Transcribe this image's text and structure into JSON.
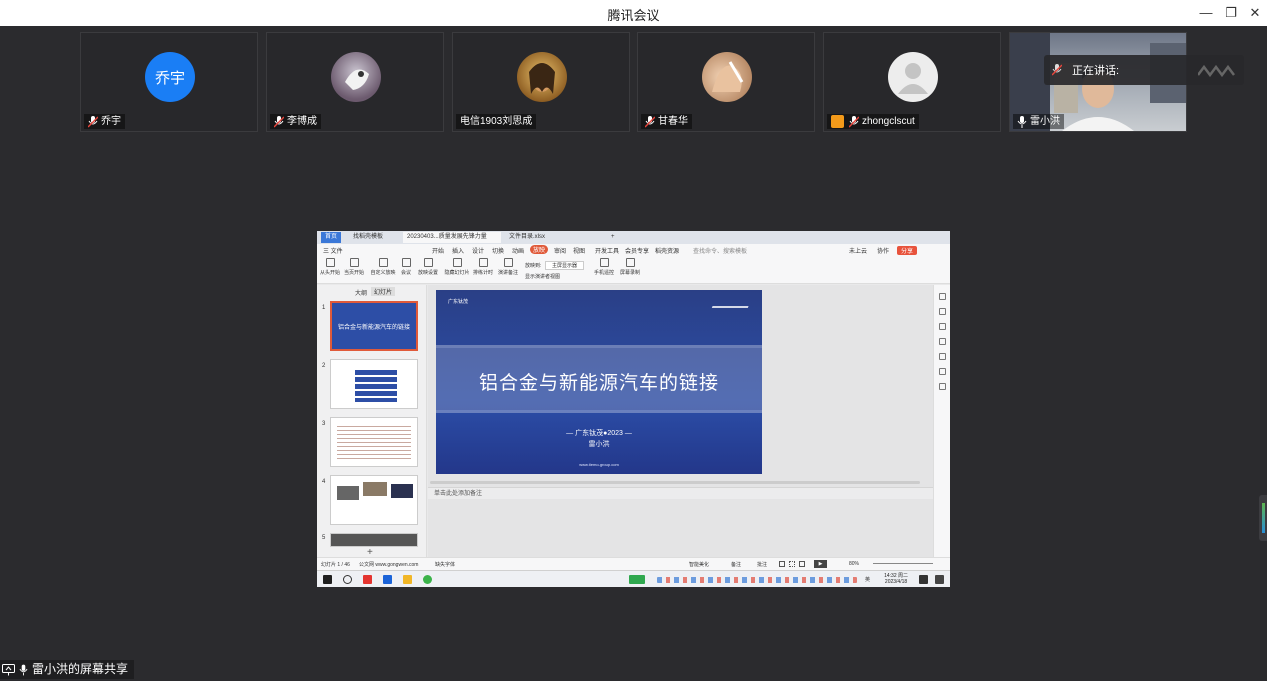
{
  "window": {
    "title": "腾讯会议"
  },
  "participants": [
    {
      "name": "乔宇",
      "avatar_text": "乔宇",
      "avatar_color": "#1a7ef5"
    },
    {
      "name": "李博成"
    },
    {
      "name": "电信1903刘思成"
    },
    {
      "name": "甘春华"
    },
    {
      "name": "zhongclscut"
    },
    {
      "name": "雷小洪"
    }
  ],
  "speaking_label": "正在讲话:",
  "share_label": "雷小洪的屏幕共享",
  "shared_screen": {
    "tabs": [
      "首页",
      "找稻壳模板",
      "20230403...质量发展先锋力量",
      "文件目录.xlsx"
    ],
    "menu": [
      "三 文件",
      "开始",
      "插入",
      "设计",
      "切换",
      "动画",
      "放映",
      "审阅",
      "视图",
      "开发工具",
      "会员专享",
      "稻壳资源",
      "查找命令、搜索模板"
    ],
    "menu_right": [
      "未上云",
      "协作",
      "分享"
    ],
    "ribbon": [
      "从头开始",
      "当页开始",
      "自定义放映",
      "会议",
      "放映设置",
      "隐藏幻灯片",
      "排练计时",
      "演讲备注",
      "手机遥控",
      "屏幕录制"
    ],
    "ribbon_options": {
      "display_label": "放映到:",
      "display_value": "主屏显示器",
      "presenter_view": "显示演讲者视图"
    },
    "panel_tabs": [
      "大纲",
      "幻灯片"
    ],
    "thumb_numbers": [
      "1",
      "2",
      "3",
      "4",
      "5"
    ],
    "thumb1_title": "铝合金与新能源汽车的链接",
    "slide": {
      "tag": "广东钛茂",
      "title": "铝合金与新能源汽车的链接",
      "subtitle": "— 广东钛茂●2023 —",
      "author": "雷小洪",
      "url": "www.tiemo-group.com"
    },
    "notes_placeholder": "单击此处添加备注",
    "status": {
      "slide_count": "幻灯片 1 / 46",
      "source": "公文网 www.gongwen.com",
      "missing_font": "缺失字体",
      "smart_beautify": "智能美化",
      "notes": "备注",
      "comments": "批注",
      "zoom": "80%"
    },
    "taskbar": {
      "time": "14:32 周二",
      "date": "2023/4/18",
      "lang": "英"
    }
  }
}
